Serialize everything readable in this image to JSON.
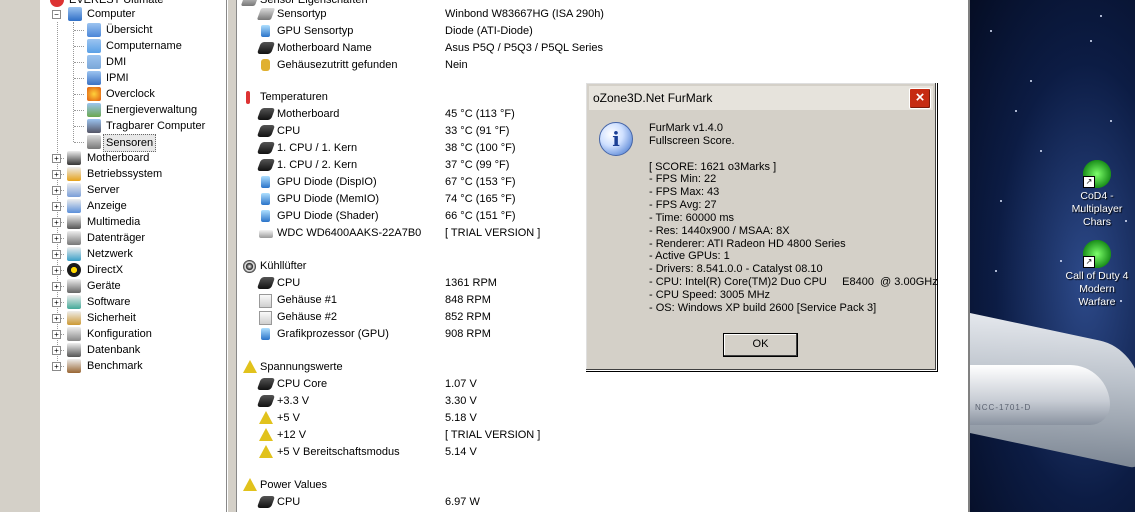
{
  "tree": {
    "top_partial": "EVEREST Ultimate",
    "computer": "Computer",
    "computer_children": [
      "Übersicht",
      "Computername",
      "DMI",
      "IPMI",
      "Overclock",
      "Energieverwaltung",
      "Tragbarer Computer",
      "Sensoren"
    ],
    "categories": [
      "Motherboard",
      "Betriebssystem",
      "Server",
      "Anzeige",
      "Multimedia",
      "Datenträger",
      "Netzwerk",
      "DirectX",
      "Geräte",
      "Software",
      "Sicherheit",
      "Konfiguration",
      "Datenbank",
      "Benchmark"
    ]
  },
  "list": {
    "top_partial": "Sensor Eigenschaften",
    "rows": [
      {
        "name": "Sensortyp",
        "value": "Winbond W83667HG  (ISA 290h)"
      },
      {
        "name": "GPU Sensortyp",
        "value": "Diode  (ATI-Diode)"
      },
      {
        "name": "Motherboard Name",
        "value": "Asus P5Q / P5Q3 / P5QL Series"
      },
      {
        "name": "Gehäusezutritt gefunden",
        "value": "Nein"
      }
    ],
    "sections": [
      {
        "title": "Temperaturen",
        "rows": [
          {
            "name": "Motherboard",
            "value": "45 °C  (113 °F)"
          },
          {
            "name": "CPU",
            "value": "33 °C  (91 °F)"
          },
          {
            "name": "1. CPU / 1. Kern",
            "value": "38 °C  (100 °F)"
          },
          {
            "name": "1. CPU / 2. Kern",
            "value": "37 °C  (99 °F)"
          },
          {
            "name": "GPU Diode (DispIO)",
            "value": "67 °C  (153 °F)"
          },
          {
            "name": "GPU Diode (MemIO)",
            "value": "74 °C  (165 °F)"
          },
          {
            "name": "GPU Diode (Shader)",
            "value": "66 °C  (151 °F)"
          },
          {
            "name": "WDC WD6400AAKS-22A7B0",
            "value": "[ TRIAL VERSION ]"
          }
        ]
      },
      {
        "title": "Kühllüfter",
        "rows": [
          {
            "name": "CPU",
            "value": "1361 RPM"
          },
          {
            "name": "Gehäuse #1",
            "value": "848 RPM"
          },
          {
            "name": "Gehäuse #2",
            "value": "852 RPM"
          },
          {
            "name": "Grafikprozessor (GPU)",
            "value": "908 RPM"
          }
        ]
      },
      {
        "title": "Spannungswerte",
        "rows": [
          {
            "name": "CPU Core",
            "value": "1.07 V"
          },
          {
            "name": "+3.3 V",
            "value": "3.30 V"
          },
          {
            "name": "+5 V",
            "value": "5.18 V"
          },
          {
            "name": "+12 V",
            "value": "[ TRIAL VERSION ]"
          },
          {
            "name": "+5 V Bereitschaftsmodus",
            "value": "5.14 V"
          }
        ]
      },
      {
        "title": "Power Values",
        "rows": [
          {
            "name": "CPU",
            "value": "6.97 W"
          }
        ]
      }
    ]
  },
  "dialog": {
    "title": "oZone3D.Net FurMark",
    "close": "×",
    "icon": "i",
    "lines": [
      "FurMark v1.4.0",
      "Fullscreen Score.",
      "",
      "[ SCORE: 1621 o3Marks ]",
      "- FPS Min: 22",
      "- FPS Max: 43",
      "- FPS Avg: 27",
      "- Time: 60000 ms",
      "- Res: 1440x900 / MSAA: 8X",
      "- Renderer: ATI Radeon HD 4800 Series",
      "- Active GPUs: 1",
      "- Drivers: 8.541.0.0 - Catalyst 08.10",
      "- CPU: Intel(R) Core(TM)2 Duo CPU     E8400  @ 3.00GHz",
      "- CPU Speed: 3005 MHz",
      "- OS: Windows XP build 2600 [Service Pack 3]"
    ],
    "ok": "OK"
  },
  "desktop": {
    "icons": [
      {
        "label": "CoD4 - Multiplayer Chars"
      },
      {
        "label": "Call of Duty 4 Modern Warfare"
      }
    ],
    "ship_text": "NCC-1701-D"
  }
}
